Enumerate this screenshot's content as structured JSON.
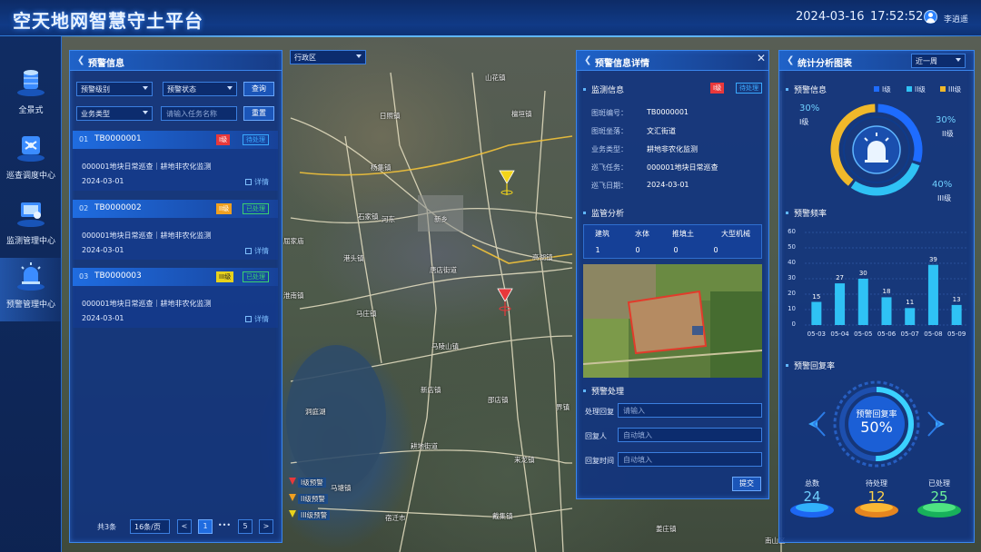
{
  "header": {
    "title": "空天地网智慧守土平台",
    "date": "2024-03-16",
    "time": "17:52:52",
    "username": "李逍遥"
  },
  "nav": [
    {
      "label": "全景式"
    },
    {
      "label": "巡查调度中心"
    },
    {
      "label": "监测管理中心"
    },
    {
      "label": "预警管理中心"
    }
  ],
  "map": {
    "district_select": "行政区",
    "labels": [
      "山花镇",
      "日照镇",
      "杨集镇",
      "石家镇",
      "新乡",
      "港头镇",
      "屈家庙",
      "淮南镇",
      "河东",
      "马庄镇",
      "唐店街道",
      "高湖镇",
      "檀垣镇",
      "马陵山镇",
      "新店镇",
      "邵店镇",
      "耕地街道",
      "来龙镇",
      "马塘镇",
      "宿迁市",
      "姜庄镇",
      "洞庭湖",
      "戴集镇",
      "界镇",
      "南山区"
    ],
    "markers": [
      "I级预警",
      "II级预警",
      "III级预警"
    ]
  },
  "alert_panel": {
    "title": "预警信息",
    "filter_level": "预警级别",
    "filter_status": "预警状态",
    "query": "查询",
    "filter_type": "业务类型",
    "search_placeholder": "请输入任务名称",
    "reset": "重置",
    "items": [
      {
        "num": "01",
        "id": "TB0000001",
        "level": "I级",
        "status": "待处理",
        "desc": "000001地块日常巡查｜耕地非农化监测",
        "date": "2024-03-01",
        "link": "详情"
      },
      {
        "num": "02",
        "id": "TB0000002",
        "level": "II级",
        "status": "已处理",
        "desc": "000001地块日常巡查｜耕地非农化监测",
        "date": "2024-03-01",
        "link": "详情"
      },
      {
        "num": "03",
        "id": "TB0000003",
        "level": "III级",
        "status": "已处理",
        "desc": "000001地块日常巡查｜耕地非农化监测",
        "date": "2024-03-01",
        "link": "详情"
      }
    ],
    "pager": {
      "total": "共3条",
      "page_size": "16条/页",
      "prev": "<",
      "current": "1",
      "ellipsis": "•••",
      "last": "5",
      "next": ">"
    }
  },
  "detail_panel": {
    "title": "预警信息详情",
    "sec_monitor": "监测信息",
    "level_tag": "I级",
    "status_tag": "待处理",
    "fields": [
      {
        "k": "图斑编号：",
        "v": "TB0000001"
      },
      {
        "k": "图斑坐落：",
        "v": "文汇街道"
      },
      {
        "k": "业务类型：",
        "v": "耕地非农化监测"
      },
      {
        "k": "巡飞任务：",
        "v": "000001地块日常巡查"
      },
      {
        "k": "巡飞日期：",
        "v": "2024-03-01"
      }
    ],
    "sec_analysis": "监管分析",
    "table_head": [
      "建筑",
      "水体",
      "推填土",
      "大型机械"
    ],
    "table_row": [
      "1",
      "0",
      "0",
      "0"
    ],
    "sec_handle": "预警处理",
    "reply_label": "处理回复",
    "reply_placeholder": "请输入",
    "person_label": "回复人",
    "person_placeholder": "自动填入",
    "time_label": "回复时间",
    "time_placeholder": "自动填入",
    "submit": "提交"
  },
  "stats_panel": {
    "title": "统计分析图表",
    "period": "近一周",
    "sec_info": "预警信息",
    "legend": [
      "I级",
      "II级",
      "III级"
    ],
    "donut": [
      {
        "name": "I级",
        "pct": "30%",
        "value": 30
      },
      {
        "name": "II级",
        "pct": "30%",
        "value": 30
      },
      {
        "name": "III级",
        "pct": "40%",
        "value": 40
      }
    ],
    "sec_freq": "预警频率",
    "sec_reply": "预警回复率",
    "reply_label": "预警回复率",
    "reply_value": "50%",
    "totals": [
      {
        "label": "总数",
        "value": "24"
      },
      {
        "label": "待处理",
        "value": "12"
      },
      {
        "label": "已处理",
        "value": "25"
      }
    ]
  },
  "colors": {
    "level1": "#e8383b",
    "level2": "#f0a020",
    "level3": "#e8d21c",
    "done": "#3bd16f",
    "pending": "#3aa9ff",
    "bar": "#2fc2f5"
  },
  "chart_data": {
    "type": "bar",
    "title": "预警频率",
    "categories": [
      "05-03",
      "05-04",
      "05-05",
      "05-06",
      "05-07",
      "05-08",
      "05-09"
    ],
    "values": [
      15,
      27,
      30,
      18,
      11,
      39,
      13
    ],
    "ylim": [
      0,
      60
    ],
    "yticks": [
      0,
      10,
      20,
      30,
      40,
      50,
      60
    ]
  }
}
